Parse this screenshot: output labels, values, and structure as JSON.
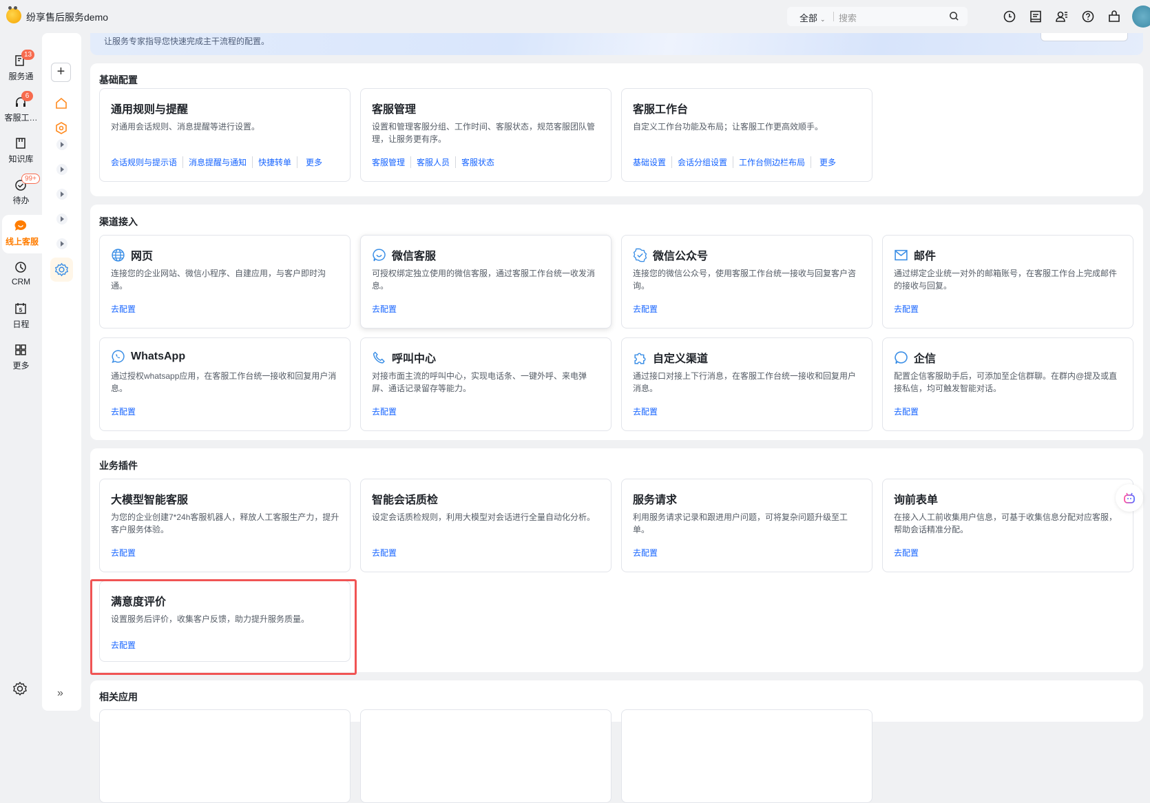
{
  "app": {
    "title": "纷享售后服务demo"
  },
  "search": {
    "scope": "全部",
    "placeholder": "搜索"
  },
  "top_icons": [
    "clock-icon",
    "inbox-icon",
    "contacts-icon",
    "help-icon",
    "bag-icon"
  ],
  "rail": [
    {
      "label": "服务通",
      "badge": "13",
      "icon": "service-icon"
    },
    {
      "label": "客服工…",
      "badge": "6",
      "icon": "headset-icon"
    },
    {
      "label": "知识库",
      "badge": null,
      "icon": "book-icon"
    },
    {
      "label": "待办",
      "badge": "99+",
      "icon": "check-circle-icon"
    },
    {
      "label": "线上客服",
      "badge": null,
      "icon": "chat-bubble-icon",
      "active": true
    },
    {
      "label": "CRM",
      "badge": null,
      "icon": "crm-clock-icon"
    },
    {
      "label": "日程",
      "badge": null,
      "icon": "calendar-icon",
      "day": "5"
    },
    {
      "label": "更多",
      "badge": null,
      "icon": "grid-icon"
    }
  ],
  "banner": {
    "text": "让服务专家指导您快速完成主干流程的配置。"
  },
  "accent": "#1664ff",
  "sections": [
    {
      "title": "基础配置",
      "cards": [
        {
          "title": "通用规则与提醒",
          "desc": "对通用会话规则、消息提醒等进行设置。",
          "links": [
            "会话规则与提示语",
            "消息提醒与通知",
            "快捷转单",
            "更多"
          ]
        },
        {
          "title": "客服管理",
          "desc": "设置和管理客服分组、工作时间、客服状态，规范客服团队管理，让服务更有序。",
          "links": [
            "客服管理",
            "客服人员",
            "客服状态"
          ]
        },
        {
          "title": "客服工作台",
          "desc": "自定义工作台功能及布局；让客服工作更高效顺手。",
          "links": [
            "基础设置",
            "会话分组设置",
            "工作台侧边栏布局",
            "更多"
          ]
        }
      ]
    },
    {
      "title": "渠道接入",
      "cards": [
        {
          "title": "网页",
          "icon": "globe-icon",
          "desc": "连接您的企业网站、微信小程序、自建应用，与客户即时沟通。",
          "links": [
            "去配置"
          ]
        },
        {
          "title": "微信客服",
          "icon": "wechat-service-icon",
          "desc": "可授权绑定独立使用的微信客服，通过客服工作台统一收发消息。",
          "links": [
            "去配置"
          ]
        },
        {
          "title": "微信公众号",
          "icon": "badge-check-icon",
          "desc": "连接您的微信公众号，使用客服工作台统一接收与回复客户咨询。",
          "links": [
            "去配置"
          ]
        },
        {
          "title": "邮件",
          "icon": "mail-icon",
          "desc": "通过绑定企业统一对外的邮箱账号，在客服工作台上完成邮件的接收与回复。",
          "links": [
            "去配置"
          ]
        },
        {
          "title": "WhatsApp",
          "icon": "whatsapp-icon",
          "desc": "通过授权whatsapp应用，在客服工作台统一接收和回复用户消息。",
          "links": [
            "去配置"
          ]
        },
        {
          "title": "呼叫中心",
          "icon": "phone-icon",
          "desc": "对接市面主流的呼叫中心，实现电话条、一键外呼、来电弹屏、通话记录留存等能力。",
          "links": [
            "去配置"
          ]
        },
        {
          "title": "自定义渠道",
          "icon": "puzzle-icon",
          "desc": "通过接口对接上下行消息，在客服工作台统一接收和回复用户消息。",
          "links": [
            "去配置"
          ]
        },
        {
          "title": "企信",
          "icon": "message-circle-icon",
          "desc": "配置企信客服助手后，可添加至企信群聊。在群内@提及或直接私信，均可触发智能对话。",
          "links": [
            "去配置"
          ]
        }
      ]
    },
    {
      "title": "业务插件",
      "cards": [
        {
          "title": "大模型智能客服",
          "desc": "为您的企业创建7*24h客服机器人，释放人工客服生产力，提升客户服务体验。",
          "links": [
            "去配置"
          ]
        },
        {
          "title": "智能会话质检",
          "desc": "设定会话质检规则，利用大模型对会话进行全量自动化分析。",
          "links": [
            "去配置"
          ]
        },
        {
          "title": "服务请求",
          "desc": "利用服务请求记录和跟进用户问题，可将复杂问题升级至工单。",
          "links": [
            "去配置"
          ]
        },
        {
          "title": "询前表单",
          "desc": "在接入人工前收集用户信息，可基于收集信息分配对应客服，帮助会话精准分配。",
          "links": [
            "去配置"
          ]
        },
        {
          "title": "满意度评价",
          "desc": "设置服务后评价，收集客户反馈，助力提升服务质量。",
          "links": [
            "去配置"
          ],
          "highlighted": true
        }
      ]
    },
    {
      "title": "相关应用",
      "cards": []
    }
  ]
}
